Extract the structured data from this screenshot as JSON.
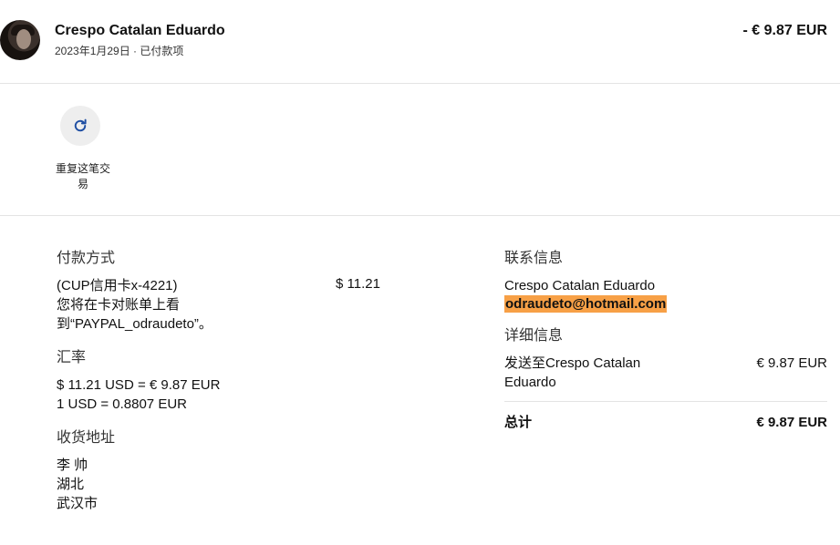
{
  "header": {
    "name": "Crespo Catalan Eduardo",
    "subtitle": "2023年1月29日 · 已付款项",
    "amount": "- € 9.87 EUR"
  },
  "action": {
    "icon": "refresh-icon",
    "label": "重复这笔交易"
  },
  "payment": {
    "title": "付款方式",
    "method": "(CUP信用卡x-4221)",
    "note": "您将在卡对账单上看到“PAYPAL_odraudeto”。",
    "amount": "$ 11.21"
  },
  "exchange": {
    "title": "汇率",
    "line1": "$ 11.21 USD = € 9.87 EUR",
    "line2": "1 USD = 0.8807 EUR"
  },
  "shipping": {
    "title": "收货地址",
    "line1": "李 帅",
    "line2": "湖北",
    "line3": "武汉市"
  },
  "contact": {
    "title": "联系信息",
    "name": "Crespo Catalan Eduardo",
    "email": "odraudeto@hotmail.com"
  },
  "details": {
    "title": "详细信息",
    "item_label": "发送至Crespo Catalan Eduardo",
    "item_value": "€ 9.87 EUR",
    "total_label": "总计",
    "total_value": "€ 9.87 EUR"
  },
  "colors": {
    "highlight": "#f7a046",
    "icon": "#1f4fa3"
  }
}
